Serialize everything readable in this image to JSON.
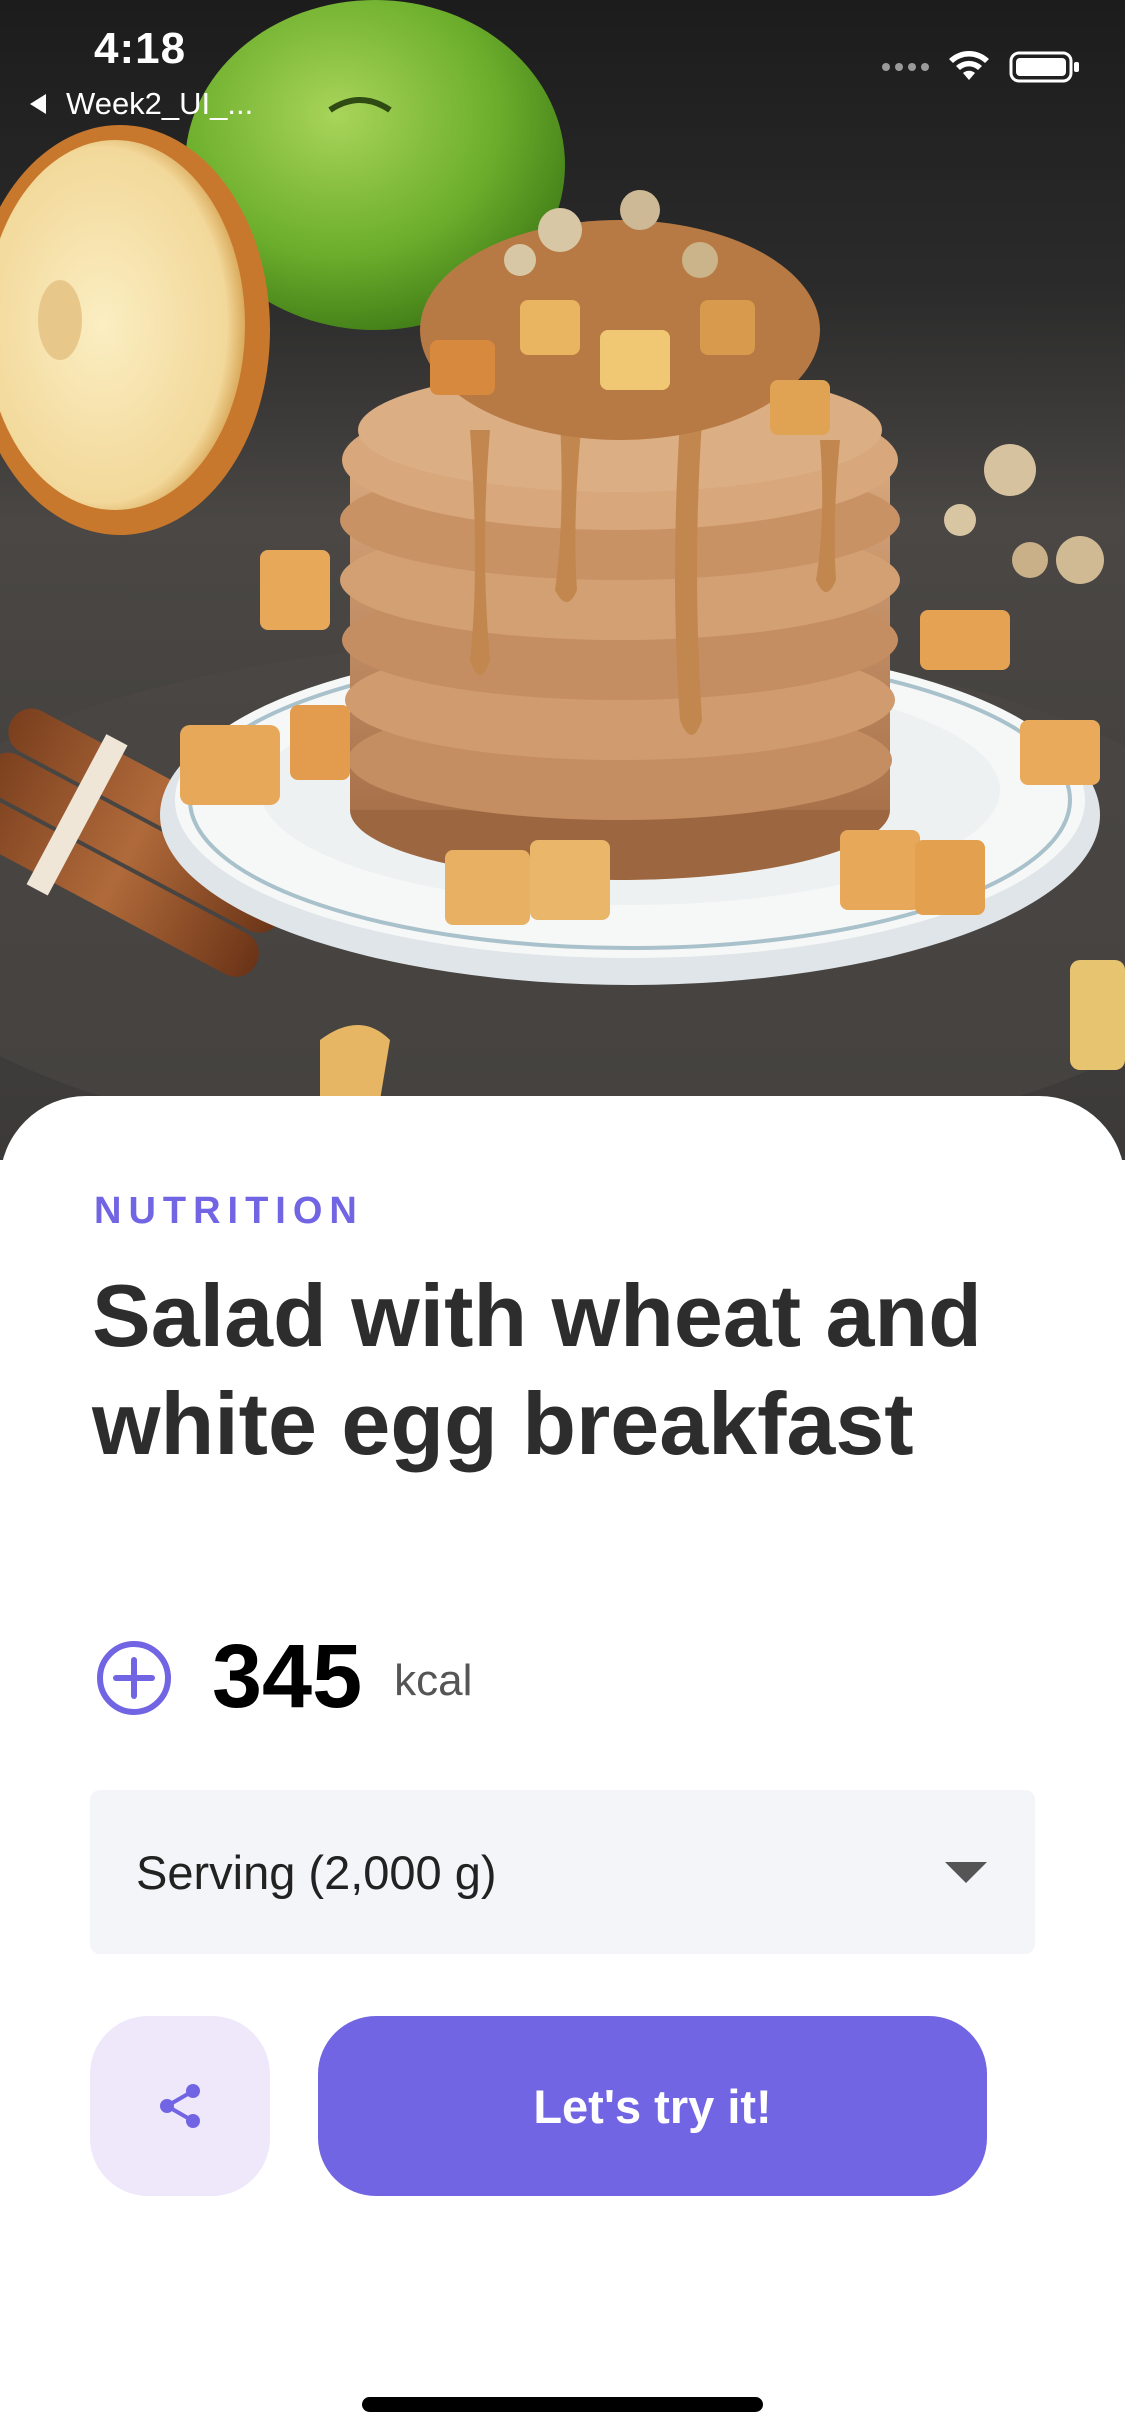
{
  "status_bar": {
    "time": "4:18",
    "back_label": "Week2_UI_...",
    "icons": [
      "cellular-signal-icon",
      "wifi-icon",
      "battery-icon"
    ]
  },
  "hero": {
    "image_subject": "stack of pancakes topped with apple pieces, granola and nut butter, with green apples and cinnamon sticks"
  },
  "recipe": {
    "category": "NUTRITION",
    "title": "Salad with wheat and white egg breakfast",
    "calories": "345",
    "calorie_unit": "kcal"
  },
  "serving": {
    "selected": "Serving (2,000 g)"
  },
  "actions": {
    "share_icon": "share-icon",
    "cta_label": "Let's try it!"
  },
  "colors": {
    "accent": "#7265e3",
    "accent_soft": "#efe8fb",
    "field_bg": "#f4f5f8",
    "title_text": "#2d2d2d"
  }
}
